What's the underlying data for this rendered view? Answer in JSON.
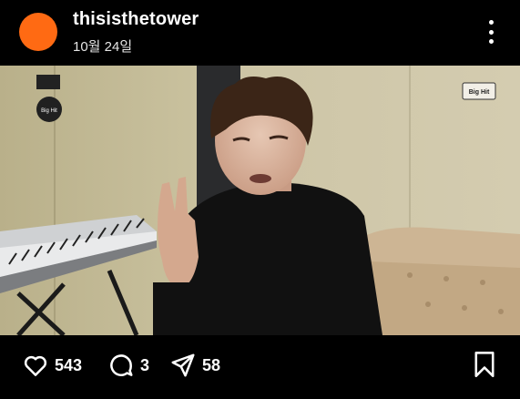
{
  "post": {
    "username": "thisisthetower",
    "date": "10월 24일",
    "avatar_color": "#ff6a13"
  },
  "media": {
    "logo_left_text": "Big Hit",
    "logo_right_text": "Big Hit"
  },
  "actions": {
    "like_count": "543",
    "comment_count": "3",
    "share_count": "58"
  },
  "icons": [
    "more-vertical-icon",
    "heart-icon",
    "comment-icon",
    "send-icon",
    "bookmark-icon"
  ]
}
